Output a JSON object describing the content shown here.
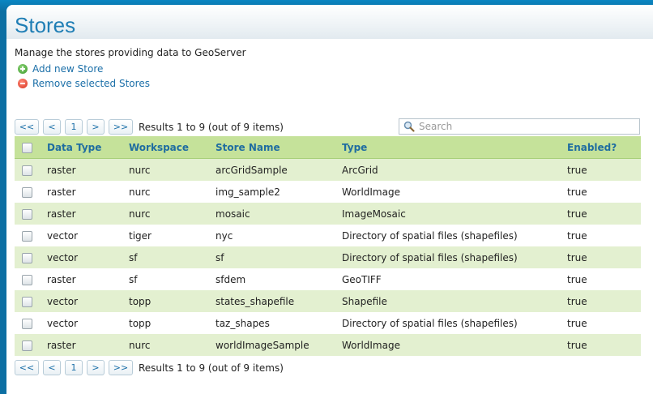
{
  "header": {
    "title": "Stores"
  },
  "description": "Manage the stores providing data to GeoServer",
  "actions": {
    "add_label": "Add new Store",
    "remove_label": "Remove selected Stores"
  },
  "pager": {
    "first": "<<",
    "prev": "<",
    "page": "1",
    "next": ">",
    "last": ">>",
    "results": "Results 1 to 9 (out of 9 items)"
  },
  "search": {
    "placeholder": "Search",
    "value": ""
  },
  "table": {
    "columns": [
      "Data Type",
      "Workspace",
      "Store Name",
      "Type",
      "Enabled?"
    ],
    "rows": [
      [
        "raster",
        "nurc",
        "arcGridSample",
        "ArcGrid",
        "true"
      ],
      [
        "raster",
        "nurc",
        "img_sample2",
        "WorldImage",
        "true"
      ],
      [
        "raster",
        "nurc",
        "mosaic",
        "ImageMosaic",
        "true"
      ],
      [
        "vector",
        "tiger",
        "nyc",
        "Directory of spatial files (shapefiles)",
        "true"
      ],
      [
        "vector",
        "sf",
        "sf",
        "Directory of spatial files (shapefiles)",
        "true"
      ],
      [
        "raster",
        "sf",
        "sfdem",
        "GeoTIFF",
        "true"
      ],
      [
        "vector",
        "topp",
        "states_shapefile",
        "Shapefile",
        "true"
      ],
      [
        "vector",
        "topp",
        "taz_shapes",
        "Directory of spatial files (shapefiles)",
        "true"
      ],
      [
        "raster",
        "nurc",
        "worldImageSample",
        "WorldImage",
        "true"
      ]
    ]
  },
  "colors": {
    "header_bar": "#0c6fa3",
    "title": "#1f7eb5",
    "table_header": "#c5e29a",
    "row_alt": "#e3f0d0"
  }
}
